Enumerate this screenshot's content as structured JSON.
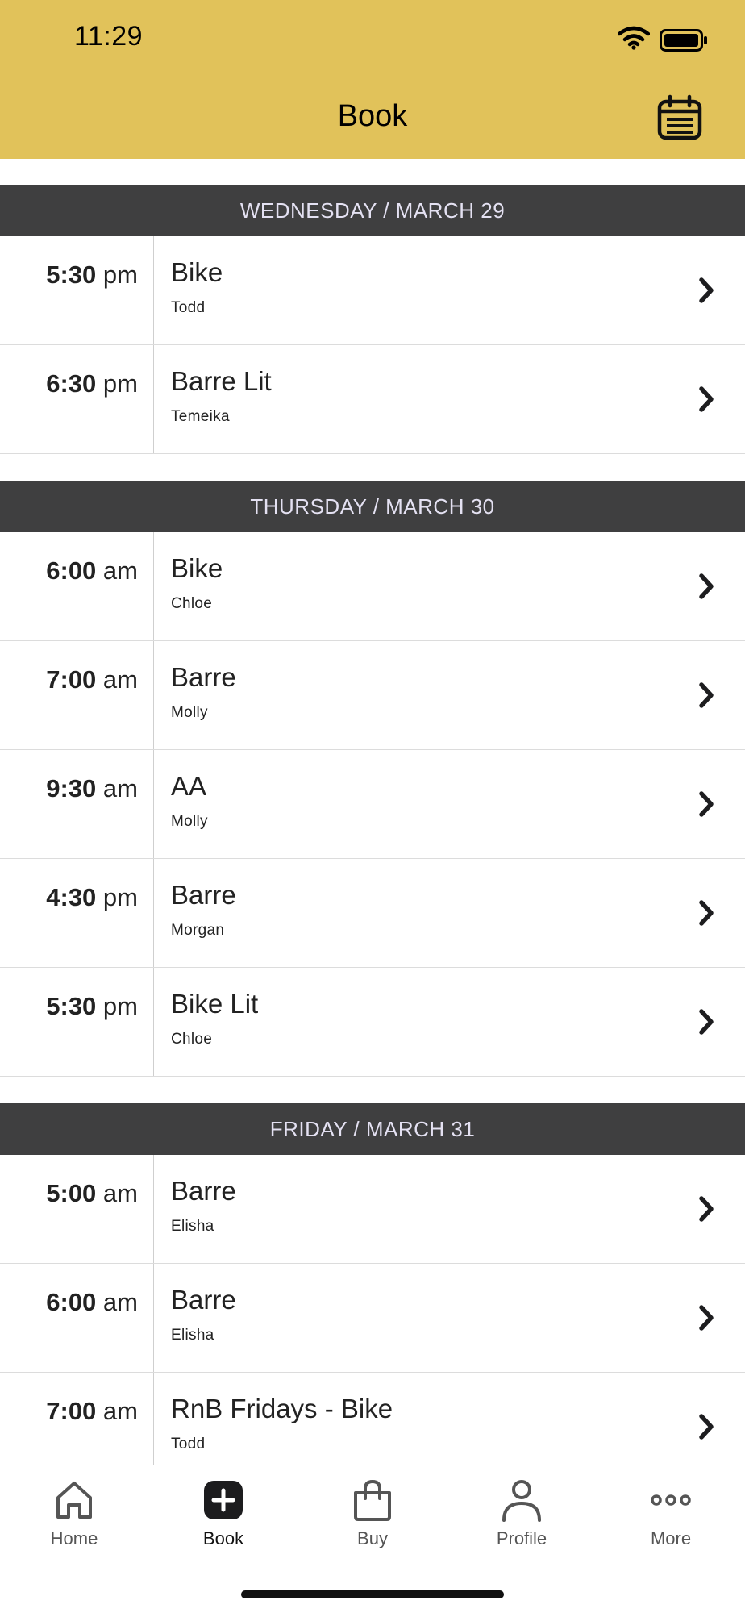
{
  "status_bar": {
    "time": "11:29"
  },
  "header": {
    "title": "Book",
    "calendar_icon": "calendar-icon",
    "background": "#e1c25a"
  },
  "days": [
    {
      "label": "WEDNESDAY / MARCH 29",
      "classes": [
        {
          "time": "5:30",
          "ampm": "pm",
          "name": "Bike",
          "instructor": "Todd"
        },
        {
          "time": "6:30",
          "ampm": "pm",
          "name": "Barre Lit",
          "instructor": "Temeika"
        }
      ]
    },
    {
      "label": "THURSDAY / MARCH 30",
      "classes": [
        {
          "time": "6:00",
          "ampm": "am",
          "name": "Bike",
          "instructor": "Chloe"
        },
        {
          "time": "7:00",
          "ampm": "am",
          "name": "Barre",
          "instructor": "Molly"
        },
        {
          "time": "9:30",
          "ampm": "am",
          "name": "AA",
          "instructor": "Molly"
        },
        {
          "time": "4:30",
          "ampm": "pm",
          "name": "Barre",
          "instructor": "Morgan"
        },
        {
          "time": "5:30",
          "ampm": "pm",
          "name": "Bike Lit",
          "instructor": "Chloe"
        }
      ]
    },
    {
      "label": "FRIDAY / MARCH 31",
      "classes": [
        {
          "time": "5:00",
          "ampm": "am",
          "name": "Barre",
          "instructor": "Elisha"
        },
        {
          "time": "6:00",
          "ampm": "am",
          "name": "Barre",
          "instructor": "Elisha"
        },
        {
          "time": "7:00",
          "ampm": "am",
          "name": "RnB Fridays - Bike",
          "instructor": "Todd"
        }
      ]
    }
  ],
  "tabbar": {
    "items": [
      {
        "label": "Home",
        "icon": "home-icon"
      },
      {
        "label": "Book",
        "icon": "plus-icon",
        "active": true
      },
      {
        "label": "Buy",
        "icon": "shopping-bag-icon"
      },
      {
        "label": "Profile",
        "icon": "person-icon"
      },
      {
        "label": "More",
        "icon": "more-icon"
      }
    ]
  }
}
